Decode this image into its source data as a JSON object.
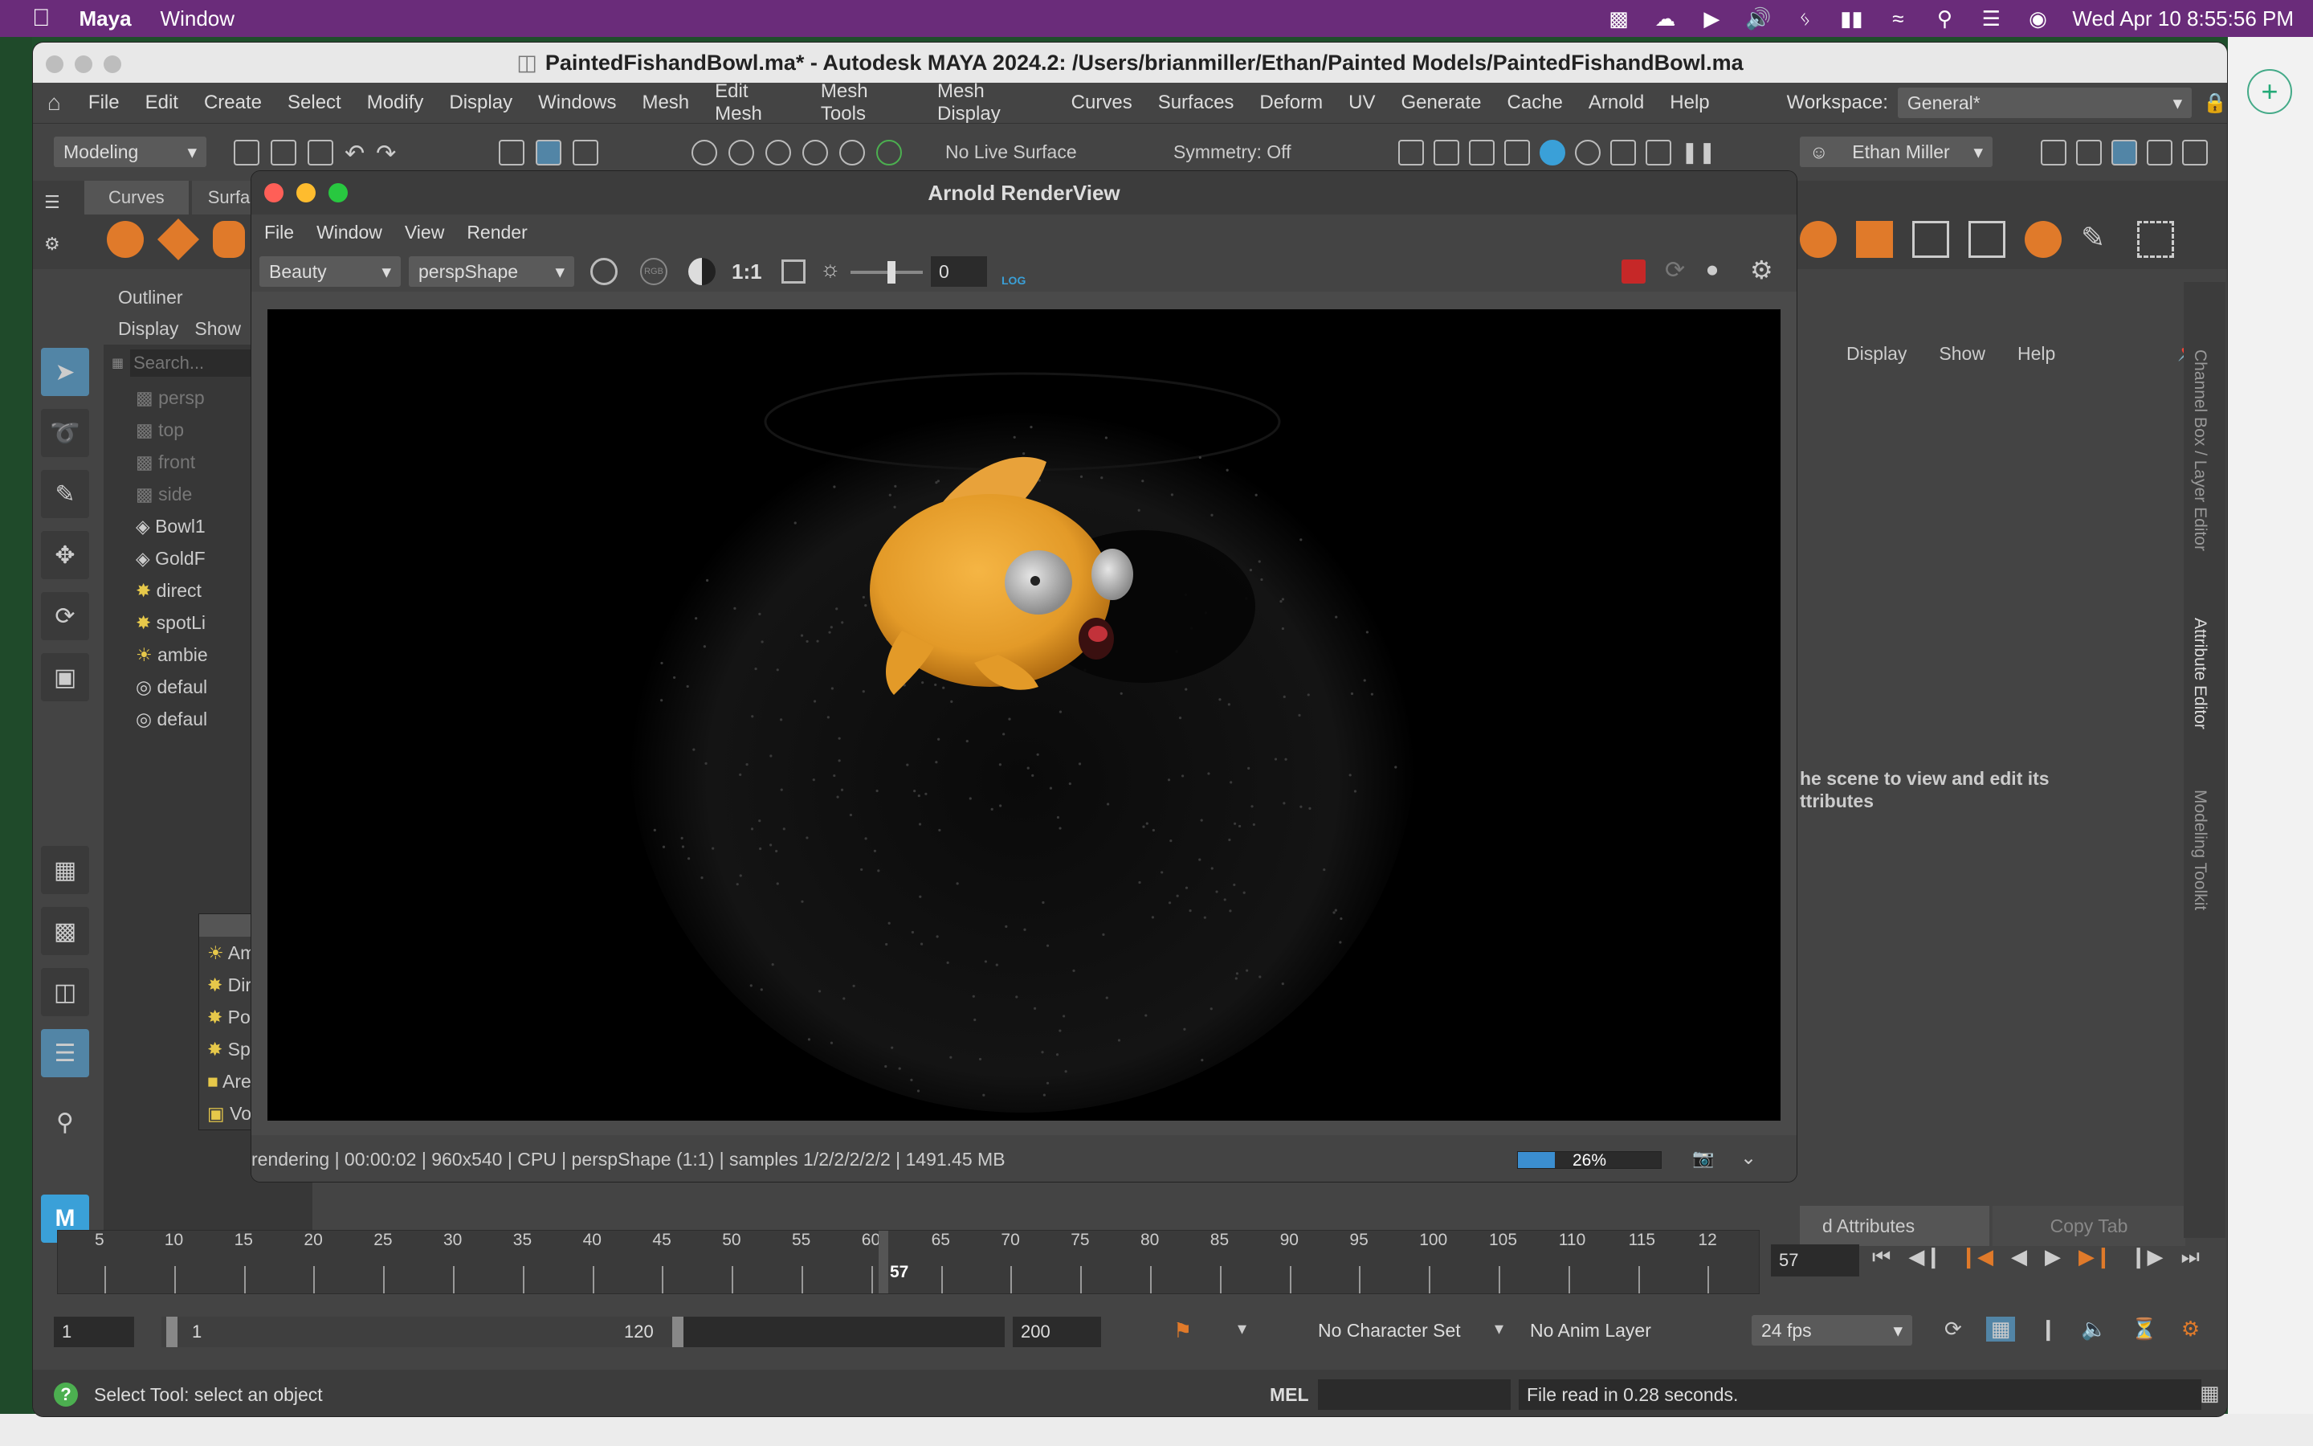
{
  "mac_menubar": {
    "app": "Maya",
    "items": [
      "Window"
    ],
    "datetime": "Wed Apr 10  8:55:56 PM"
  },
  "maya": {
    "title": "PaintedFishandBowl.ma* - Autodesk MAYA 2024.2: /Users/brianmiller/Ethan/Painted Models/PaintedFishandBowl.ma",
    "menus": [
      "File",
      "Edit",
      "Create",
      "Select",
      "Modify",
      "Display",
      "Windows",
      "Mesh",
      "Edit Mesh",
      "Mesh Tools",
      "Mesh Display",
      "Curves",
      "Surfaces",
      "Deform",
      "UV",
      "Generate",
      "Cache",
      "Arnold",
      "Help"
    ],
    "workspace_label": "Workspace:",
    "workspace_value": "General*",
    "menu_set": "Modeling",
    "live_surface": "No Live Surface",
    "symmetry": "Symmetry: Off",
    "user": "Ethan Miller",
    "shelf_tabs": [
      "Curves",
      "Surfa"
    ],
    "outliner": {
      "title": "Outliner",
      "menus": [
        "Display",
        "Show"
      ],
      "search_placeholder": "Search...",
      "items": [
        "persp",
        "top",
        "front",
        "side",
        "Bowl1",
        "GoldF",
        "direct",
        "spotLi",
        "ambie",
        "defaul",
        "defaul"
      ]
    },
    "light_panel": {
      "items": [
        "Ambi",
        "Direc",
        "Point",
        "Spot",
        "Area",
        "Volu"
      ]
    },
    "attribute_editor": {
      "menus": [
        "Display",
        "Show",
        "Help"
      ],
      "message_line1": "he scene to view and edit its",
      "message_line2": "ttributes",
      "tab_attributes": "d Attributes",
      "tab_copy": "Copy Tab",
      "side_tabs": [
        "Channel Box / Layer Editor",
        "Attribute Editor",
        "Modeling Toolkit"
      ]
    },
    "timeline": {
      "ticks": [
        "5",
        "10",
        "15",
        "20",
        "25",
        "30",
        "35",
        "40",
        "45",
        "50",
        "55",
        "60",
        "65",
        "70",
        "75",
        "80",
        "85",
        "90",
        "95",
        "100",
        "105",
        "110",
        "115",
        "12"
      ],
      "current_frame_marker": "57",
      "current_frame_field": "57",
      "range_start": "1",
      "range_inner_start": "1",
      "range_inner_end": "120",
      "range_end": "200",
      "character_set": "No Character Set",
      "anim_layer": "No Anim Layer",
      "fps": "24 fps"
    },
    "helpline": {
      "message": "Select Tool: select an object",
      "mel_label": "MEL",
      "result": "File read in  0.28 seconds."
    }
  },
  "arnold": {
    "title": "Arnold RenderView",
    "menus": [
      "File",
      "Window",
      "View",
      "Render"
    ],
    "aov": "Beauty",
    "camera": "perspShape",
    "ratio": "1:1",
    "exposure": "0",
    "log": "LOG",
    "status": "rendering | 00:00:02 | 960x540 | CPU | perspShape (1:1) | samples 1/2/2/2/2/2 | 1491.45 MB",
    "progress": 0.26,
    "progress_label": "26%"
  }
}
